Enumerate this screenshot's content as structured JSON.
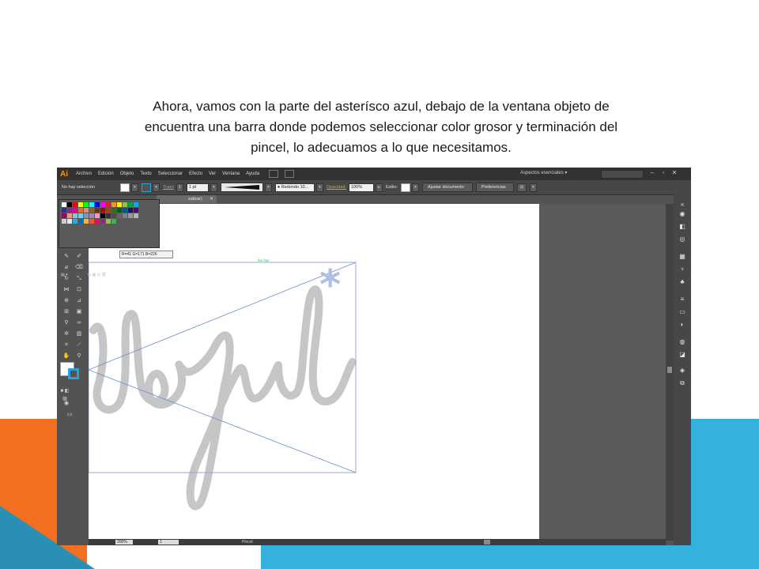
{
  "slide": {
    "caption_line1": "Ahora, vamos con la parte del asterísco azul,  debajo de la ventana objeto de",
    "caption_line2": "encuentra una barra donde podemos seleccionar color grosor y terminación del",
    "caption_line3": "pincel, lo adecuamos a lo que necesitamos."
  },
  "app": {
    "logo": "Ai",
    "menu": [
      "Archivo",
      "Edición",
      "Objeto",
      "Texto",
      "Seleccionar",
      "Efecto",
      "Ver",
      "Ventana",
      "Ayuda"
    ],
    "workspace": "Aspectos esenciales  ▾",
    "window_controls": [
      "–",
      "▫",
      "✕"
    ]
  },
  "control_bar": {
    "selection_label": "No hay selección",
    "stroke_label": "Trazo",
    "stroke_weight": "1 pt",
    "brush_name": "Redondo 10...",
    "opacity_label": "Opacidad:",
    "opacity_value": "100%",
    "style_label": "Estilo:",
    "align_doc_button": "Ajustar documento",
    "preferences_button": "Preferencias"
  },
  "tab": {
    "title": "zalizar)",
    "close": "✕"
  },
  "swatch_panel": {
    "tooltip": "R=41 G=171 B=226",
    "colors": [
      "#ffffff",
      "#000000",
      "#ff0000",
      "#ffff00",
      "#00ff00",
      "#00ffff",
      "#0000ff",
      "#ff00ff",
      "#ed1c24",
      "#f7941e",
      "#fff200",
      "#8dc63f",
      "#00a651",
      "#00aeef",
      "#2e3192",
      "#92278f",
      "#ec008c",
      "#f26522",
      "#c69c6d",
      "#8c6239",
      "#603913",
      "#9e0b0f",
      "#a0410d",
      "#406618",
      "#005e20",
      "#005b7f",
      "#1b1464",
      "#440e62",
      "#9e005d",
      "#f7977a",
      "#7accc8",
      "#6dcff6",
      "#8393ca",
      "#a186be",
      "#f49ac1",
      "#000000",
      "#333333",
      "#4d4d4d",
      "#666666",
      "#808080",
      "#999999",
      "#b3b3b3",
      "#cccccc",
      "#e6e6e6",
      "#29abe2",
      "#0071bc",
      "#fbb03b",
      "#f15a24",
      "#d4145a",
      "#93278f",
      "#8cc63f",
      "#39b54a"
    ]
  },
  "status_bar": {
    "zoom": "200%",
    "page": "1",
    "tool": "Pincel"
  },
  "canvas": {
    "text_label": "Anclaje",
    "stroke_color": "#9aa9d6",
    "lettering_color": "#c6c6c6",
    "asterisk_color": "#aebfe6"
  }
}
